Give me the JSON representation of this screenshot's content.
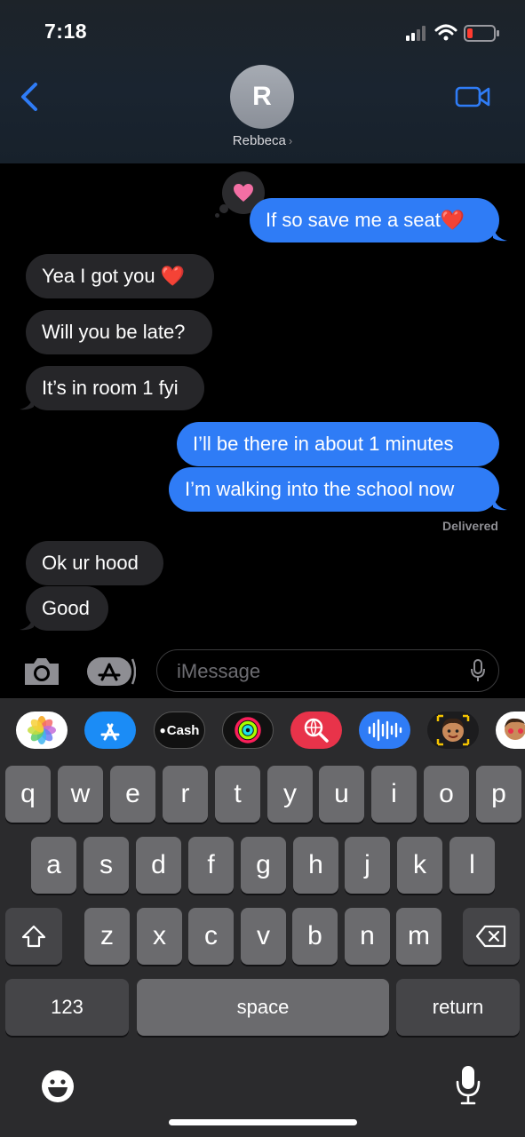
{
  "status_bar": {
    "time": "7:18"
  },
  "header": {
    "avatar_initial": "R",
    "contact_name": "Rebbeca",
    "chevron": "›"
  },
  "messages": [
    {
      "dir": "out",
      "text": "If so save me a seat❤️"
    },
    {
      "dir": "in",
      "text": "Yea I got you ❤️"
    },
    {
      "dir": "in",
      "text": "Will you be late?"
    },
    {
      "dir": "in",
      "text": "It’s in room 1 fyi"
    },
    {
      "dir": "out",
      "text": "I’ll be there in about 1 minutes"
    },
    {
      "dir": "out",
      "text": "I’m walking into the school now"
    },
    {
      "dir": "in",
      "text": "Ok ur hood"
    },
    {
      "dir": "in",
      "text": "Good"
    }
  ],
  "tapback": {
    "icon": "heart-icon",
    "color": "#f36fa4"
  },
  "delivered_label": "Delivered",
  "compose": {
    "placeholder": "iMessage"
  },
  "app_rail": {
    "cash_label": "Cash"
  },
  "keyboard": {
    "row1": [
      "q",
      "w",
      "e",
      "r",
      "t",
      "y",
      "u",
      "i",
      "o",
      "p"
    ],
    "row2": [
      "a",
      "s",
      "d",
      "f",
      "g",
      "h",
      "j",
      "k",
      "l"
    ],
    "row3": [
      "z",
      "x",
      "c",
      "v",
      "b",
      "n",
      "m"
    ],
    "numbers_label": "123",
    "space_label": "space",
    "return_label": "return"
  },
  "colors": {
    "outgoing": "#2f7cf6",
    "incoming": "#262629",
    "accent": "#2f7cf6"
  }
}
